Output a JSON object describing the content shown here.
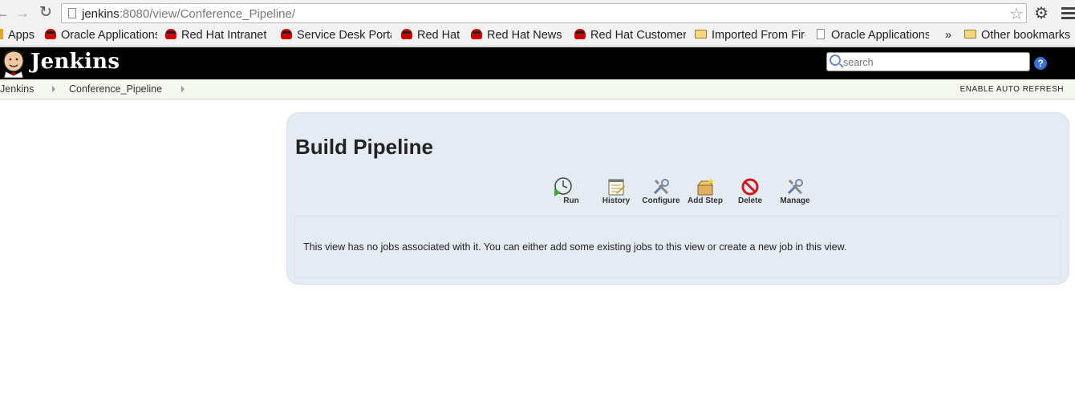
{
  "browser": {
    "url_host": "jenkins",
    "url_rest": ":8080/view/Conference_Pipeline/",
    "bookmarks": [
      {
        "label": "Apps",
        "icon": "apps-icon"
      },
      {
        "label": "Oracle Applications",
        "icon": "redhat-icon"
      },
      {
        "label": "Red Hat Intranet",
        "icon": "redhat-icon"
      },
      {
        "label": "Service Desk Portal",
        "icon": "redhat-icon"
      },
      {
        "label": "Red Hat",
        "icon": "redhat-icon"
      },
      {
        "label": "Red Hat News",
        "icon": "redhat-icon"
      },
      {
        "label": "Red Hat Customer",
        "icon": "redhat-icon"
      },
      {
        "label": "Imported From Firefox",
        "icon": "folder-icon"
      },
      {
        "label": "Oracle Applications",
        "icon": "page-icon"
      },
      {
        "label": "»",
        "icon": ""
      },
      {
        "label": "Other bookmarks",
        "icon": "folder-icon"
      }
    ]
  },
  "header": {
    "logo_text": "Jenkins",
    "search_placeholder": "search",
    "help_label": "?"
  },
  "breadcrumbs": {
    "items": [
      "Jenkins",
      "Conference_Pipeline"
    ],
    "auto_refresh": "ENABLE AUTO REFRESH"
  },
  "main": {
    "title": "Build Pipeline",
    "actions": [
      {
        "label": "Run",
        "icon": "run-icon"
      },
      {
        "label": "History",
        "icon": "history-icon"
      },
      {
        "label": "Configure",
        "icon": "configure-icon"
      },
      {
        "label": "Add Step",
        "icon": "add-step-icon"
      },
      {
        "label": "Delete",
        "icon": "delete-icon"
      },
      {
        "label": "Manage",
        "icon": "manage-icon"
      }
    ],
    "message": "This view has no jobs associated with it. You can either add some existing jobs to this view or create a new job in this view."
  },
  "colors": {
    "header_bg": "#000000",
    "panel_bg": "#e5ebf3",
    "breadcrumb_bg": "#f5f7f1"
  }
}
